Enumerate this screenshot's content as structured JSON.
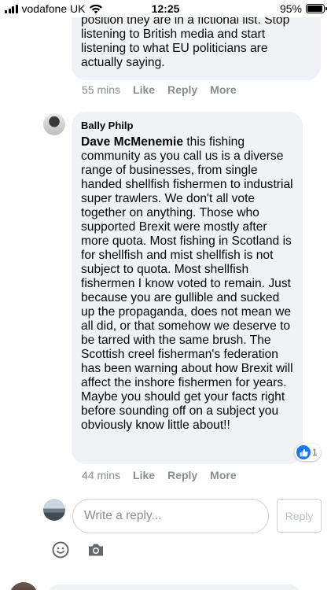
{
  "status_bar": {
    "carrier": "vodafone UK",
    "time": "12:25",
    "battery": "95%",
    "battery_level": 0.95
  },
  "comments": [
    {
      "text": "position they are in a fictional list. Stop listening to British media and start listening to what EU politicians are actually saying.",
      "time": "55 mins",
      "like": "Like",
      "reply": "Reply",
      "more": "More"
    },
    {
      "author": "Bally Philp",
      "mention": "Dave McMenemie",
      "text": " this fishing community as you call us is a diverse range of businesses, from single handed shellfish fishermen to industrial super trawlers. We don't all vote together on anything. Those who supported Brexit were mostly after more quota. Most fishing in Scotland is for shellfish and mist shellfish is not subject to quota. Most shellfish fishermen I know voted to remain. Just because you are gullible and sucked up the propaganda, does not mean we all did, or that somehow we deserve to be tarred with the same brush. The Scottish creel fisherman's federation has been warning about how Brexit will affect the inshore fishermen for years. Maybe you should get your facts right before sounding off on a subject you obviously know little about!!",
      "reaction_count": "1",
      "time": "44 mins",
      "like": "Like",
      "reply": "Reply",
      "more": "More"
    }
  ],
  "reply_box": {
    "placeholder": "Write a reply...",
    "button": "Reply"
  },
  "colors": {
    "bubble": "#f0f2f5",
    "meta_text": "#8a8d91",
    "like_blue": "#1877f2",
    "icon_gray": "#65676b"
  },
  "icons": [
    "signal-icon",
    "wifi-icon",
    "battery-icon",
    "like-reaction-icon",
    "emoji-icon",
    "camera-icon"
  ]
}
